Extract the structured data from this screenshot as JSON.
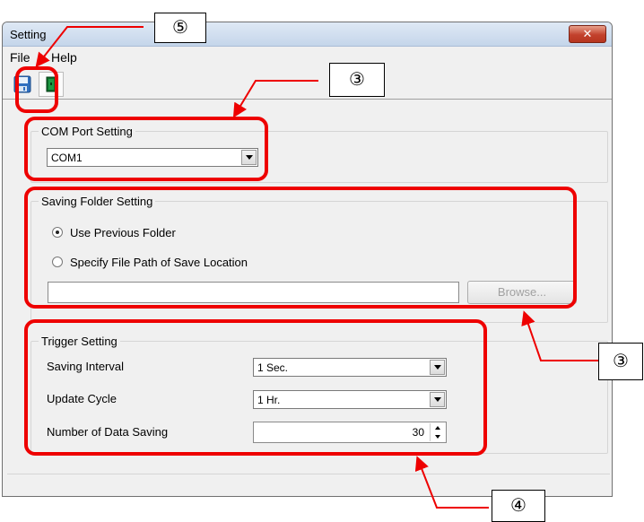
{
  "window": {
    "title": "Setting",
    "close_symbol": "✕"
  },
  "menu": {
    "items": [
      "File",
      "Help"
    ]
  },
  "toolbar": {
    "buttons": [
      "save-icon",
      "exit-icon"
    ]
  },
  "com_port": {
    "legend": "COM Port Setting",
    "value": "COM1"
  },
  "saving_folder": {
    "legend": "Saving Folder Setting",
    "options": [
      "Use Previous Folder",
      "Specify File Path of Save Location"
    ],
    "selected_index": 0,
    "path_value": "",
    "browse_label": "Browse..."
  },
  "trigger": {
    "legend": "Trigger Setting",
    "saving_interval_label": "Saving Interval",
    "saving_interval_value": "1 Sec.",
    "update_cycle_label": "Update Cycle",
    "update_cycle_value": "1 Hr.",
    "data_saving_label": "Number of Data Saving",
    "data_saving_value": "30"
  },
  "callouts": {
    "save": "⑤",
    "com": "③",
    "folder": "③",
    "trigger": "④"
  },
  "colors": {
    "highlight": "#ee0000",
    "window_bg": "#f0f0f0",
    "close_button": "#c2412c"
  }
}
